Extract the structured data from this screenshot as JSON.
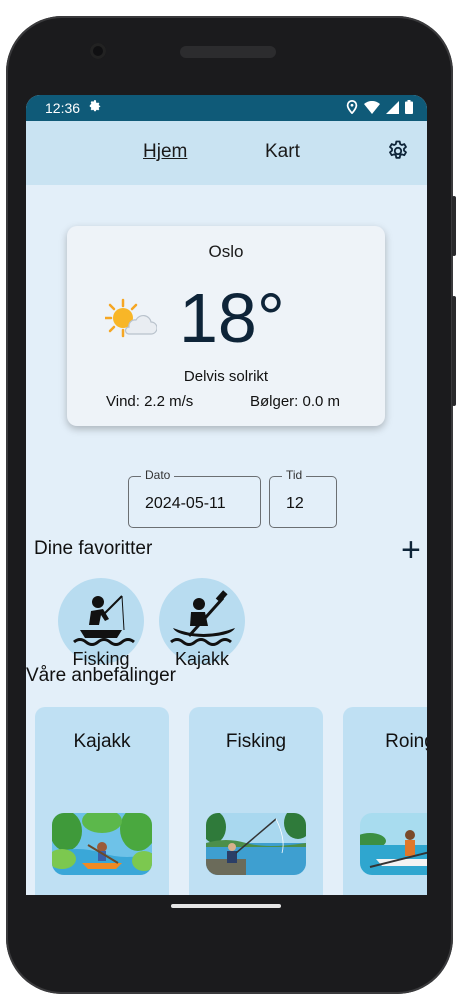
{
  "status": {
    "time": "12:36"
  },
  "nav": {
    "home": "Hjem",
    "map": "Kart"
  },
  "weather": {
    "city": "Oslo",
    "temperature": "18°",
    "description": "Delvis solrikt",
    "wind": "Vind: 2.2 m/s",
    "waves": "Bølger: 0.0 m",
    "icon": "partly-sunny-icon"
  },
  "inputs": {
    "date_label": "Dato",
    "date_value": "2024-05-11",
    "time_label": "Tid",
    "time_value": "12"
  },
  "favorites": {
    "title": "Dine favoritter",
    "add_label": "+",
    "items": [
      {
        "label": "Fisking",
        "icon": "fishing-icon"
      },
      {
        "label": "Kajakk",
        "icon": "kayak-icon"
      }
    ]
  },
  "recommendations": {
    "title": "Våre anbefalinger",
    "items": [
      {
        "label": "Kajakk"
      },
      {
        "label": "Fisking"
      },
      {
        "label": "Roing"
      }
    ]
  },
  "colors": {
    "statusbar": "#0f5a78",
    "topbar": "#c9e3f2",
    "background": "#e3eff9",
    "card": "#bfe0f3",
    "favorite": "#b8dcf0"
  }
}
